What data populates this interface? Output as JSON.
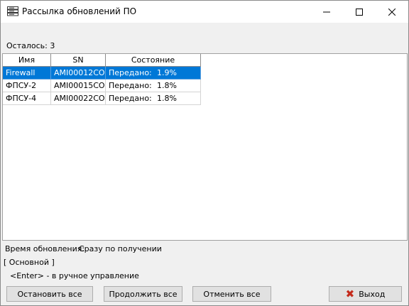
{
  "window": {
    "title": "Рассылка обновлений ПО",
    "minimize_glyph": "—",
    "maximize_glyph": "☐",
    "close_glyph": "✕",
    "icon": "server-rack-icon"
  },
  "remaining_text": "Осталось: 3",
  "table": {
    "columns": [
      "Имя",
      "SN",
      "Состояние"
    ],
    "rows": [
      {
        "name": "Firewall",
        "sn": "AMI00012CO",
        "status": "Передано:",
        "percent": "1.9%",
        "selected": true
      },
      {
        "name": "ФПСУ-2",
        "sn": "AMI00015CO",
        "status": "Передано:",
        "percent": "1.8%",
        "selected": false
      },
      {
        "name": "ФПСУ-4",
        "sn": "AMI00022CO",
        "status": "Передано:",
        "percent": "1.8%",
        "selected": false
      }
    ]
  },
  "update_time": {
    "label": "Время обновления:",
    "value": "Сразу по получении"
  },
  "panel_label": "[ Основной ]",
  "hint": "<Enter> - в ручное управление",
  "buttons": {
    "stop_all": "Остановить все",
    "continue_all": "Продолжить все",
    "cancel_all": "Отменить все",
    "exit": "Выход",
    "exit_icon": "red-x-icon"
  },
  "colors": {
    "selection": "#0078d7",
    "exit_icon": "#c42b1c"
  }
}
